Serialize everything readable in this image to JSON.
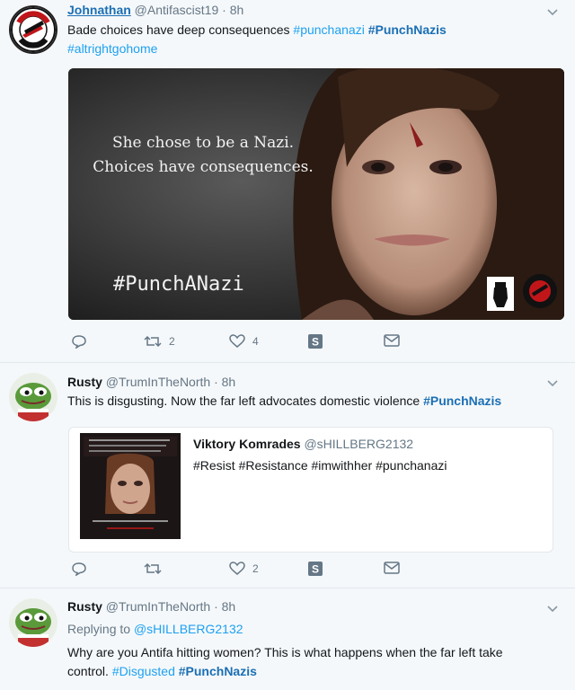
{
  "tweets": [
    {
      "author_name": "Johnathan",
      "author_handle": "@Antifascist19",
      "time": "· 8h",
      "text": "Bade choices have deep consequences",
      "hashtags": [
        "#punchanazi",
        "#PunchNazis",
        "#altrightgohome"
      ],
      "media": {
        "caption_line1": "She chose to be a Nazi.",
        "caption_line2": "Choices have consequences.",
        "hashtag": "#PunchANazi"
      },
      "retweets": "2",
      "likes": "4"
    },
    {
      "author_name": "Rusty",
      "author_handle": "@TrumInTheNorth",
      "time": "· 8h",
      "text": "This is disgusting. Now the far left advocates domestic violence",
      "hashtag": "#PunchNazis",
      "quote": {
        "author_name": "Viktory Komrades",
        "author_handle": "@sHILLBERG2132",
        "text": "#Resist #Resistance  #imwithher #punchanazi"
      },
      "retweets": "",
      "likes": "2"
    },
    {
      "author_name": "Rusty",
      "author_handle": "@TrumInTheNorth",
      "time": "· 8h",
      "replying_label": "Replying to",
      "replying_handle": "@sHILLBERG2132",
      "text_line1": "Why are you Antifa hitting women? This is what happens when the far left take",
      "text_line2": "control.",
      "hashtags": [
        "#Disgusted",
        "#PunchNazis"
      ]
    }
  ],
  "colors": {
    "link": "#1da1f2",
    "accent": "#1b6fb5",
    "muted": "#657786"
  },
  "icons": [
    "reply-icon",
    "retweet-icon",
    "like-icon",
    "share-s-icon",
    "mail-icon",
    "chevron-down-icon"
  ]
}
